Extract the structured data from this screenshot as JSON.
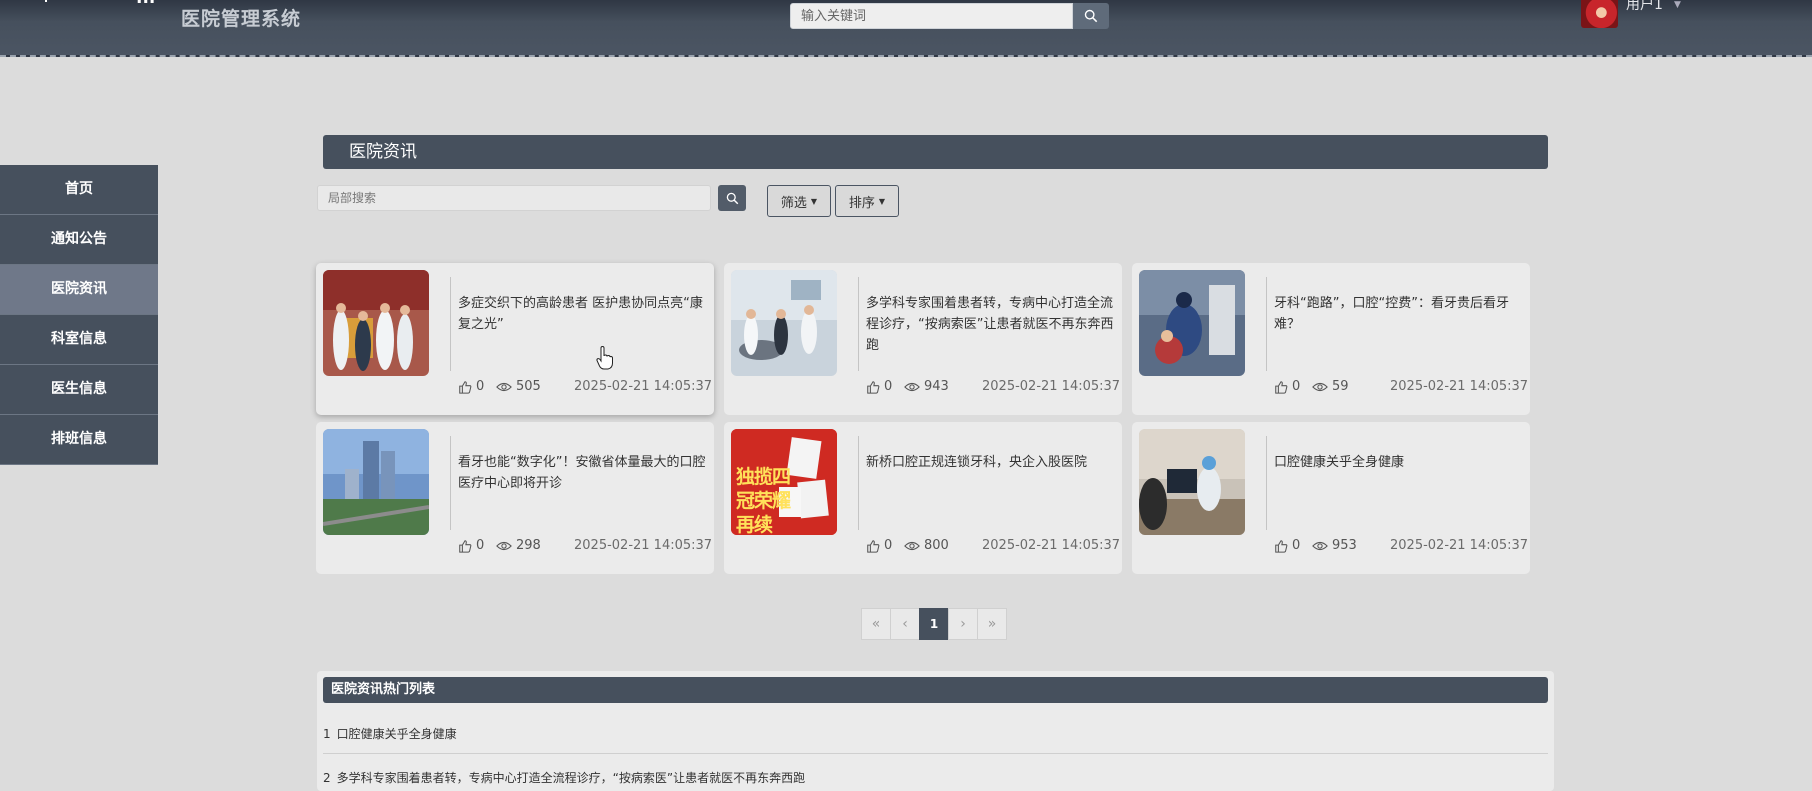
{
  "header": {
    "cut_text": "...",
    "system_title": "医院管理系统",
    "search_placeholder": "输入关键词",
    "username": "用户1",
    "icons": {
      "search": "search-icon",
      "caret": "chevron-down-icon"
    }
  },
  "sidebar": {
    "items": [
      {
        "label": "首页",
        "active": false
      },
      {
        "label": "通知公告",
        "active": false
      },
      {
        "label": "医院资讯",
        "active": true
      },
      {
        "label": "科室信息",
        "active": false
      },
      {
        "label": "医生信息",
        "active": false
      },
      {
        "label": "排班信息",
        "active": false
      }
    ]
  },
  "main": {
    "section_title": "医院资讯",
    "local_search_placeholder": "局部搜索",
    "filter_label": "筛选",
    "sort_label": "排序"
  },
  "cards": [
    {
      "title": "多症交织下的高龄患者 医护患协同点亮“康复之光”",
      "likes": "0",
      "views": "505",
      "date": "2025-02-21 14:05:37"
    },
    {
      "title": "多学科专家围着患者转，专病中心打造全流程诊疗，“按病索医”让患者就医不再东奔西跑",
      "likes": "0",
      "views": "943",
      "date": "2025-02-21 14:05:37"
    },
    {
      "title": "牙科“跑路”，口腔“控费”：看牙贵后看牙难？",
      "likes": "0",
      "views": "59",
      "date": "2025-02-21 14:05:37"
    },
    {
      "title": "看牙也能“数字化”！安徽省体量最大的口腔医疗中心即将开诊",
      "likes": "0",
      "views": "298",
      "date": "2025-02-21 14:05:37"
    },
    {
      "title": "新桥口腔正规连锁牙科，央企入股医院",
      "likes": "0",
      "views": "800",
      "date": "2025-02-21 14:05:37",
      "thumb_text": "独揽四冠荣耀再续"
    },
    {
      "title": "口腔健康关乎全身健康",
      "likes": "0",
      "views": "953",
      "date": "2025-02-21 14:05:37"
    }
  ],
  "pagination": {
    "first": "«",
    "prev": "‹",
    "current": "1",
    "next": "›",
    "last": "»"
  },
  "hot_list": {
    "title": "医院资讯热门列表",
    "items": [
      {
        "num": "1",
        "title": "口腔健康关乎全身健康"
      },
      {
        "num": "2",
        "title": "多学科专家围着患者转，专病中心打造全流程诊疗，“按病索医”让患者就医不再东奔西跑"
      }
    ]
  },
  "colors": {
    "primary": "#46505d",
    "active_nav": "#6f7889",
    "background": "#dcdcdc",
    "card": "#ebebeb"
  }
}
